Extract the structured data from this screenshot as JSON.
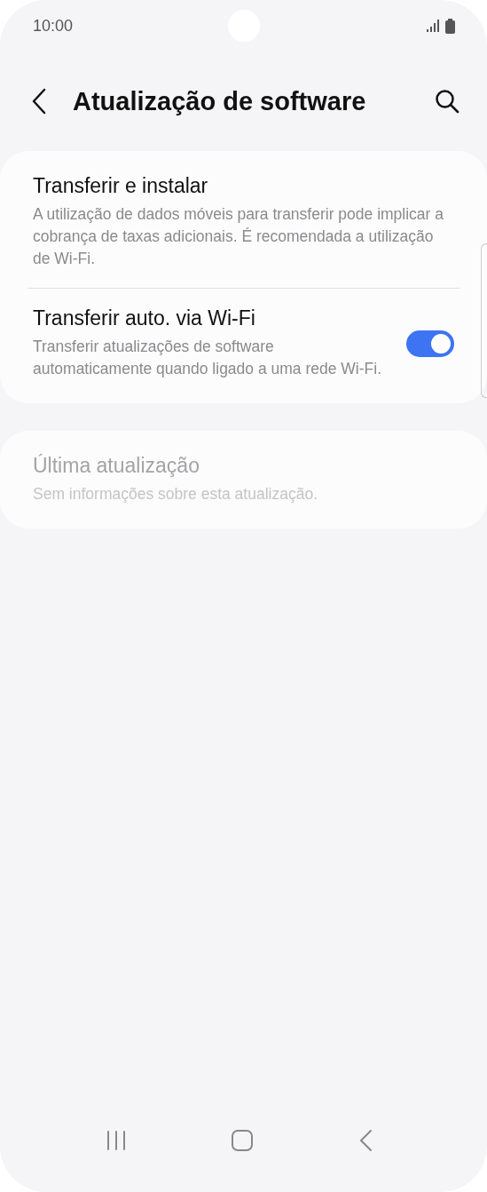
{
  "status_bar": {
    "time": "10:00"
  },
  "header": {
    "title": "Atualização de software"
  },
  "cards": [
    {
      "items": [
        {
          "kind": "link",
          "title": "Transferir e instalar",
          "subtitle": "A utilização de dados móveis para transferir pode implicar a cobrança de taxas adicionais. É recomendada a utilização de Wi-Fi.",
          "disabled": false
        },
        {
          "kind": "toggle",
          "title": "Transferir auto. via Wi-Fi",
          "subtitle": "Transferir atualizações de software automaticamente quando ligado a uma rede Wi-Fi.",
          "on": true,
          "disabled": false
        }
      ]
    },
    {
      "items": [
        {
          "kind": "link",
          "title": "Última atualização",
          "subtitle": "Sem informações sobre esta atualização.",
          "disabled": true
        }
      ]
    }
  ]
}
